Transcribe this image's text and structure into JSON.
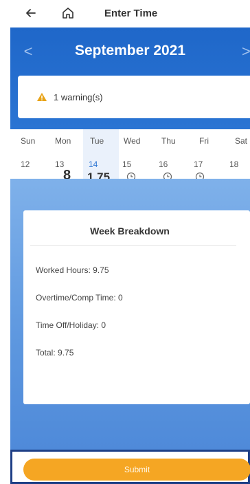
{
  "header": {
    "title": "Enter Time"
  },
  "calendar": {
    "month_label": "September 2021",
    "prev_symbol": "<",
    "next_symbol": ">"
  },
  "warning": {
    "text": "1 warning(s)"
  },
  "week": {
    "days": [
      {
        "name": "Sun",
        "num": "12",
        "hours": ""
      },
      {
        "name": "Mon",
        "num": "13",
        "hours": "8"
      },
      {
        "name": "Tue",
        "num": "14",
        "hours": "1.75"
      },
      {
        "name": "Wed",
        "num": "15",
        "hours": ""
      },
      {
        "name": "Thu",
        "num": "16",
        "hours": ""
      },
      {
        "name": "Fri",
        "num": "17",
        "hours": ""
      },
      {
        "name": "Sat",
        "num": "18",
        "hours": ""
      }
    ]
  },
  "breakdown": {
    "title": "Week Breakdown",
    "lines": [
      "Worked Hours: 9.75",
      "Overtime/Comp Time: 0",
      "Time Off/Holiday: 0",
      "Total: 9.75"
    ]
  },
  "actions": {
    "submit_label": "Submit"
  },
  "colors": {
    "primary": "#2a74d3",
    "accent": "#f5a623",
    "warning": "#e8a317"
  }
}
